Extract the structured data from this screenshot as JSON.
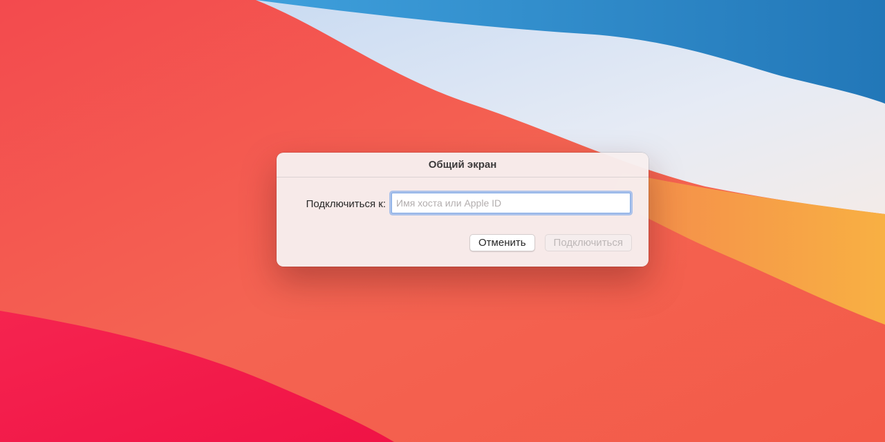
{
  "desktop": {
    "wallpaper_name": "big-sur-wallpaper",
    "colors": {
      "red": "#f35a4f",
      "blue": "#2f86c8",
      "light_blue": "#d6e4f5",
      "orange": "#f6a641",
      "magenta": "#f2164f"
    }
  },
  "dialog": {
    "title": "Общий экран",
    "connect_label": "Подключиться к:",
    "host_input": {
      "value": "",
      "placeholder": "Имя хоста или Apple ID"
    },
    "buttons": {
      "cancel": "Отменить",
      "connect": "Подключиться"
    },
    "accent_color": "#7fa9e6"
  }
}
